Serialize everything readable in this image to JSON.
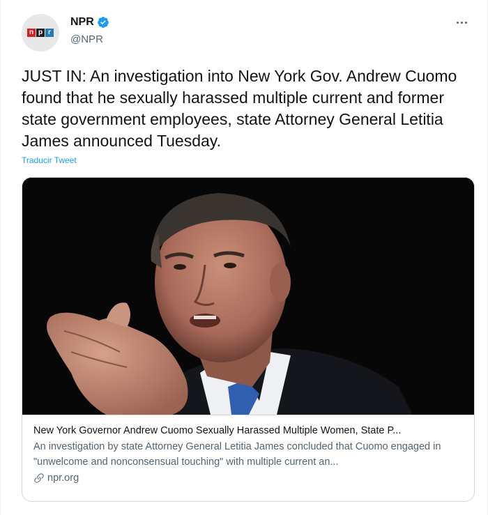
{
  "author": {
    "display_name": "NPR",
    "handle": "@NPR",
    "logo_letters": [
      "n",
      "p",
      "r"
    ],
    "verified": true
  },
  "tweet": {
    "text": "JUST IN: An investigation into New York Gov. Andrew Cuomo found that he sexually harassed multiple current and former state government employees, state Attorney General Letitia James announced Tuesday.",
    "translate_label": "Traducir Tweet"
  },
  "card": {
    "title": "New York Governor Andrew Cuomo Sexually Harassed Multiple Women, State P...",
    "description": "An investigation by state Attorney General Letitia James concluded that Cuomo engaged in \"unwelcome and nonconsensual touching\" with multiple current an...",
    "domain": "npr.org"
  },
  "icons": {
    "verified": "verified-badge-icon",
    "more": "more-options-icon",
    "link": "link-icon"
  },
  "colors": {
    "accent": "#1d9bf0",
    "text": "#0f1419",
    "secondary": "#536471",
    "border": "#cfd9de",
    "npr_red": "#d62021",
    "npr_black": "#231f20",
    "npr_blue": "#237bbd"
  }
}
